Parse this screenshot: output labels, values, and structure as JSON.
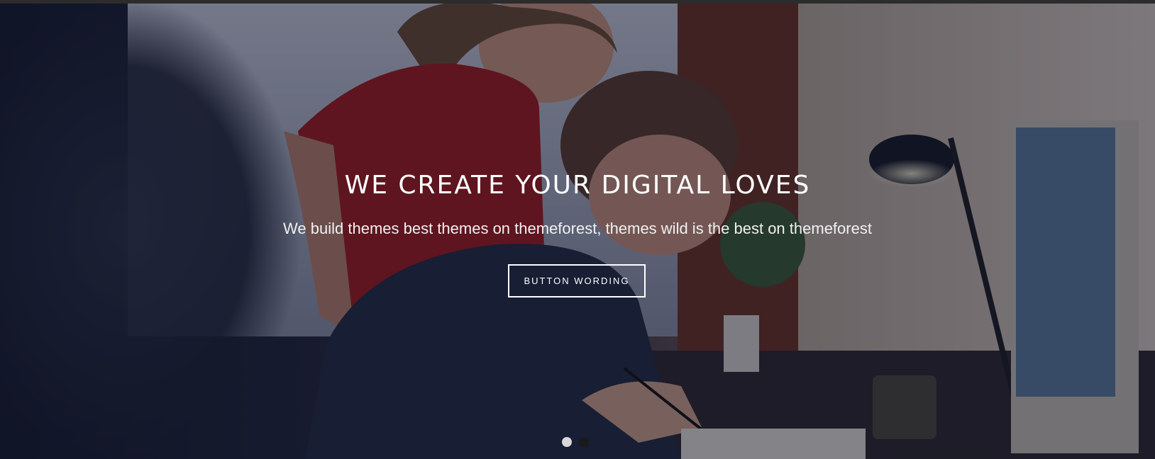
{
  "hero": {
    "title": "WE CREATE YOUR DIGITAL LOVES",
    "subtitle": "We build themes best themes on themeforest, themes wild is the best on themeforest",
    "button_label": "BUTTON WORDING",
    "slides": {
      "count": 2,
      "active_index": 0
    }
  },
  "colors": {
    "overlay": "#0e1228",
    "text": "#ffffff",
    "dot_active": "#d8d8d8",
    "dot_inactive": "#1a1a1a"
  }
}
